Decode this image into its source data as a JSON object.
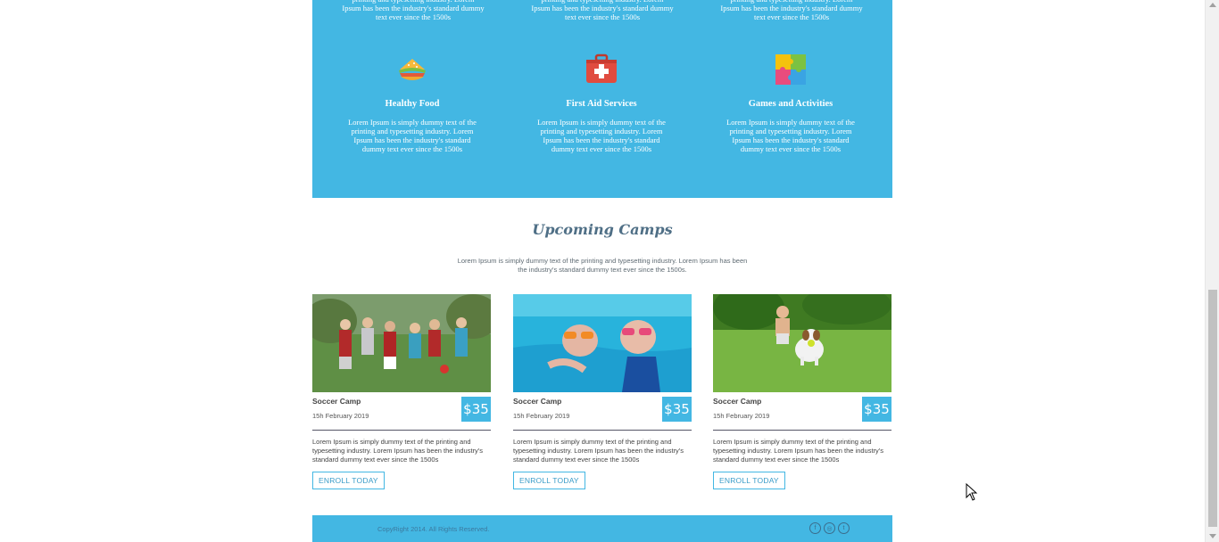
{
  "features_top": [
    "printing and typesetting industry. Lorem Ipsum has been the industry's standard dummy text ever since the 1500s",
    "printing and typesetting industry. Lorem Ipsum has been the industry's standard dummy text ever since the 1500s",
    "printing and typesetting industry. Lorem Ipsum has been the industry's standard dummy text ever since the 1500s"
  ],
  "features": [
    {
      "title": "Healthy Food",
      "icon": "sandwich-icon",
      "text": "Lorem Ipsum is simply dummy text of the printing and typesetting industry. Lorem Ipsum has been the industry's standard dummy text ever since the 1500s"
    },
    {
      "title": "First Aid Services",
      "icon": "first-aid-kit-icon",
      "text": "Lorem Ipsum is simply dummy text of the printing and typesetting industry. Lorem Ipsum has been the industry's standard dummy text ever since the 1500s"
    },
    {
      "title": "Games and Activities",
      "icon": "puzzle-icon",
      "text": "Lorem Ipsum is simply dummy text of the printing and typesetting industry. Lorem Ipsum has been the industry's standard dummy text ever since the 1500s"
    }
  ],
  "camps_section": {
    "title": "Upcoming Camps",
    "description": "Lorem Ipsum is simply dummy text of the printing and typesetting industry. Lorem Ipsum has been the industry's standard dummy text ever since the 1500s."
  },
  "camps": [
    {
      "name": "Soccer Camp",
      "date": "15h February 2019",
      "price": "$35",
      "description": "Lorem Ipsum is simply dummy text of the printing and typesetting industry. Lorem Ipsum has been the industry's standard dummy text ever since the 1500s",
      "button": "ENROLL TODAY",
      "photo": "kids-soccer-photo"
    },
    {
      "name": "Soccer Camp",
      "date": "15h February 2019",
      "price": "$35",
      "description": "Lorem Ipsum is simply dummy text of the printing and typesetting industry. Lorem Ipsum has been the industry's standard dummy text ever since the 1500s",
      "button": "ENROLL TODAY",
      "photo": "kids-swimming-photo"
    },
    {
      "name": "Soccer Camp",
      "date": "15h February 2019",
      "price": "$35",
      "description": "Lorem Ipsum is simply dummy text of the printing and typesetting industry. Lorem Ipsum has been the industry's standard dummy text ever since the 1500s",
      "button": "ENROLL TODAY",
      "photo": "boy-with-dog-photo"
    }
  ],
  "footer": {
    "copyright": "CopyRight 2014. All Rights Reserved.",
    "social": [
      "facebook-icon",
      "instagram-icon",
      "twitter-icon"
    ]
  },
  "colors": {
    "accent": "#43b7e3",
    "heading": "#4f6f86"
  }
}
